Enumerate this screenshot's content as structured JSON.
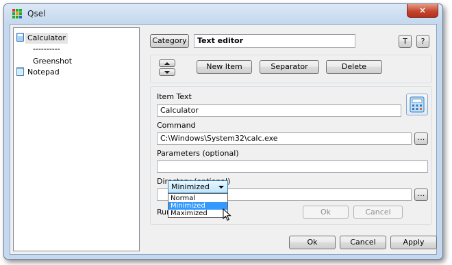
{
  "window": {
    "title": "Qsel",
    "close": "×"
  },
  "tree": [
    {
      "label": "Calculator",
      "icon": "calculator-icon"
    },
    {
      "label": "----------"
    },
    {
      "label": "Greenshot"
    },
    {
      "label": "Notepad",
      "icon": "notepad-icon"
    }
  ],
  "header": {
    "category_button": "Category",
    "category_value": "Text editor",
    "t_button": "T",
    "help_button": "?"
  },
  "toolbar": {
    "new_item": "New Item",
    "separator": "Separator",
    "delete": "Delete"
  },
  "form": {
    "item_text_label": "Item Text",
    "item_text_value": "Calculator",
    "command_label": "Command",
    "command_value": "C:\\Windows\\System32\\calc.exe",
    "browse": "...",
    "parameters_label": "Parameters (optional)",
    "parameters_value": "",
    "directory_label": "Directory (optional)",
    "directory_value": "",
    "run_label": "Run",
    "run_value": "Minimized",
    "run_options": [
      "Normal",
      "Minimized",
      "Maximized"
    ],
    "inner_ok": "Ok",
    "inner_cancel": "Cancel"
  },
  "footer": {
    "ok": "Ok",
    "cancel": "Cancel",
    "apply": "Apply"
  }
}
